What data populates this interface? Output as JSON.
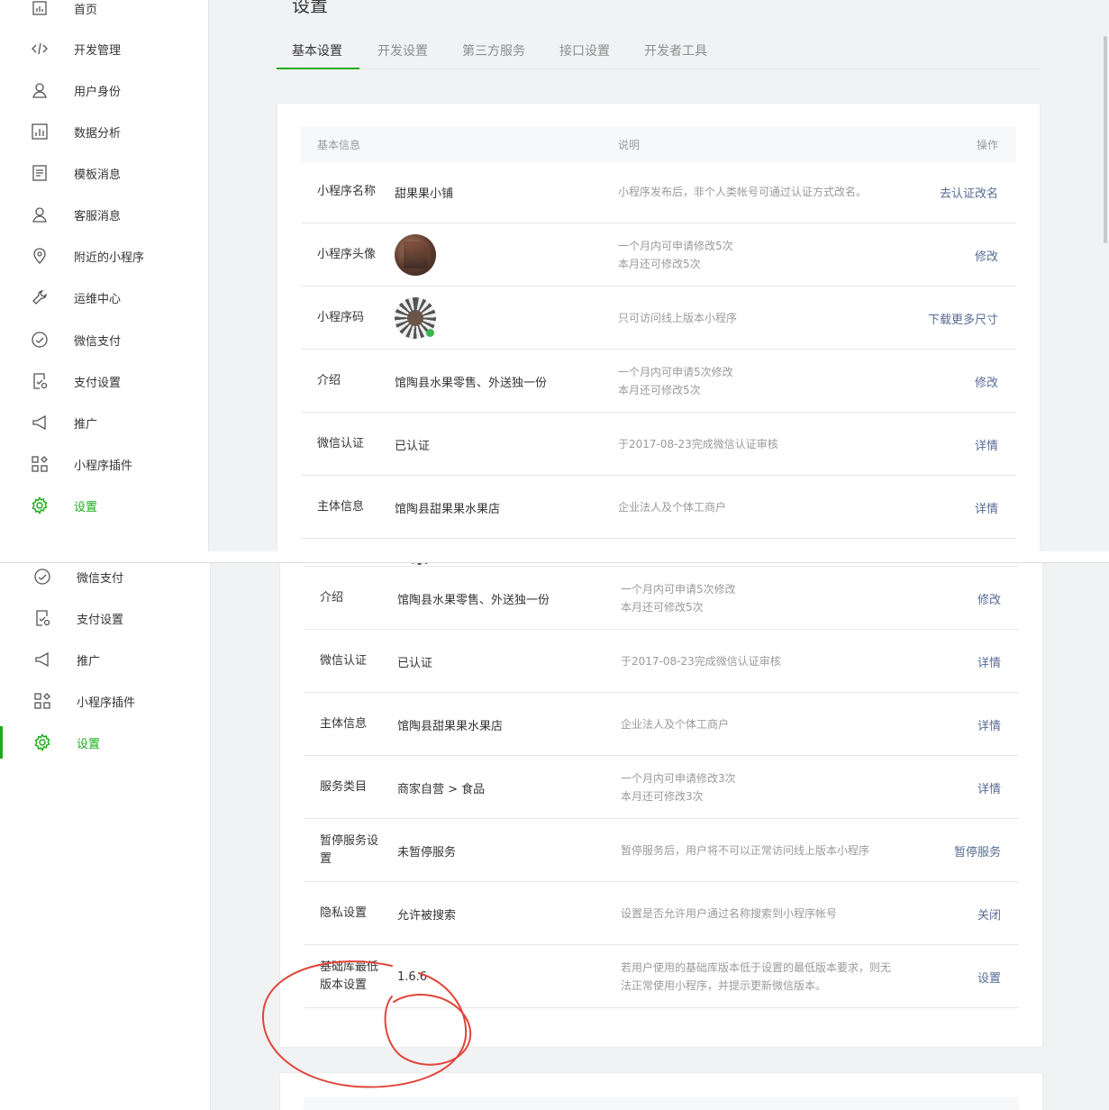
{
  "page": {
    "title": "设置"
  },
  "tabs": [
    "基本设置",
    "开发设置",
    "第三方服务",
    "接口设置",
    "开发者工具"
  ],
  "sidebar": {
    "items": [
      {
        "label": "首页",
        "icon": "home-icon"
      },
      {
        "label": "开发管理",
        "icon": "code-icon"
      },
      {
        "label": "用户身份",
        "icon": "user-icon"
      },
      {
        "label": "数据分析",
        "icon": "chart-icon"
      },
      {
        "label": "模板消息",
        "icon": "document-icon"
      },
      {
        "label": "客服消息",
        "icon": "user-icon"
      },
      {
        "label": "附近的小程序",
        "icon": "location-icon"
      },
      {
        "label": "运维中心",
        "icon": "wrench-icon"
      },
      {
        "label": "微信支付",
        "icon": "gauge-icon"
      },
      {
        "label": "支付设置",
        "icon": "payment-settings-icon"
      },
      {
        "label": "推广",
        "icon": "megaphone-icon"
      },
      {
        "label": "小程序插件",
        "icon": "plugin-icon"
      },
      {
        "label": "设置",
        "icon": "gear-icon"
      }
    ]
  },
  "table": {
    "header": {
      "col1": "基本信息",
      "col2": "说明",
      "col3": "操作"
    },
    "rows": [
      {
        "label": "小程序名称",
        "value": "甜果果小铺",
        "desc1": "小程序发布后，非个人类帐号可通过认证方式改名。",
        "desc2": "",
        "action": "去认证改名"
      },
      {
        "label": "小程序头像",
        "value": "",
        "desc1": "一个月内可申请修改5次",
        "desc2": "本月还可修改5次",
        "action": "修改"
      },
      {
        "label": "小程序码",
        "value": "",
        "desc1": "只可访问线上版本小程序",
        "desc2": "",
        "action": "下载更多尺寸"
      },
      {
        "label": "介绍",
        "value": "馆陶县水果零售、外送独一份",
        "desc1": "一个月内可申请5次修改",
        "desc2": "本月还可修改5次",
        "action": "修改"
      },
      {
        "label": "微信认证",
        "value": "已认证",
        "desc1": "于2017-08-23完成微信认证审核",
        "desc2": "",
        "action": "详情"
      },
      {
        "label": "主体信息",
        "value": "馆陶县甜果果水果店",
        "desc1": "企业法人及个体工商户",
        "desc2": "",
        "action": "详情"
      },
      {
        "label": "服务类目",
        "value": "商家自营 > 食品",
        "desc1": "一个月内可申请修改3次",
        "desc2": "本月还可修改3次",
        "action": "详情"
      },
      {
        "label": "暂停服务设置",
        "value": "未暂停服务",
        "desc1": "暂停服务后，用户将不可以正常访问线上版本小程序",
        "desc2": "",
        "action": "暂停服务"
      },
      {
        "label": "隐私设置",
        "value": "允许被搜索",
        "desc1": "设置是否允许用户通过名称搜索到小程序帐号",
        "desc2": "",
        "action": "关闭"
      },
      {
        "label": "基础库最低版本设置",
        "value": "1.6.6",
        "desc1": "若用户使用的基础库版本低于设置的最低版本要求，则无",
        "desc2": "法正常使用小程序，并提示更新微信版本。",
        "action": "设置"
      }
    ]
  },
  "colors": {
    "accent": "#1aad19",
    "link": "#576b95",
    "annotation": "#e0463a"
  }
}
